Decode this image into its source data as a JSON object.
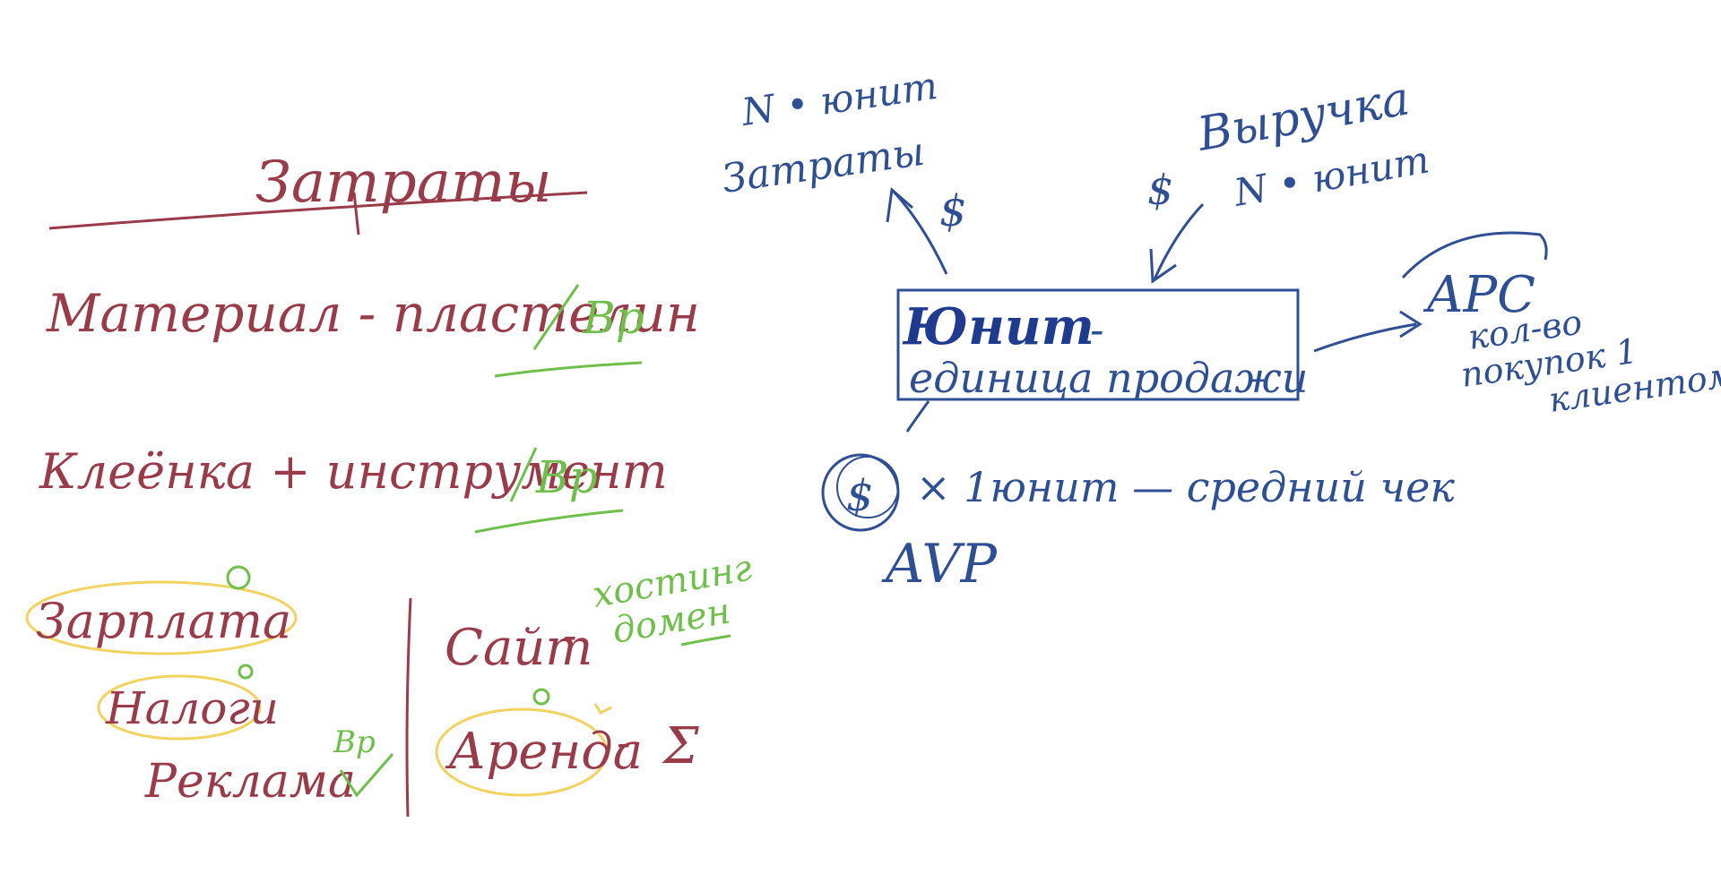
{
  "colors": {
    "red": "#9a3b4a",
    "blue": "#2f4f95",
    "green": "#6fbf4b",
    "yellow": "#f2d35f"
  },
  "costs": {
    "title": "Затраты",
    "line1": "Материал - пластелин",
    "line2": "Клеёнка + инструмент",
    "vp": "Вр",
    "salary": "Зарплата",
    "taxes": "Налоги",
    "ads": "Реклама",
    "site": "Сайт",
    "hosting": "хостинг",
    "domain": "домен",
    "rent": "Аренда",
    "sigma": "Σ",
    "dash": "-"
  },
  "unit": {
    "left_top": "N • юнит",
    "left_bottom": "Затраты",
    "dollar": "$",
    "right_top": "Выручка",
    "right_bottom": "N • юнит",
    "title": "Юнит",
    "subtitle": "единица продажи",
    "apc": "APC",
    "apc_desc_1": "кол-во",
    "apc_desc_2": "покупок 1",
    "apc_desc_3": "клиентом",
    "avg_check": "× 1юнит — средний чек",
    "avp": "AVP"
  }
}
